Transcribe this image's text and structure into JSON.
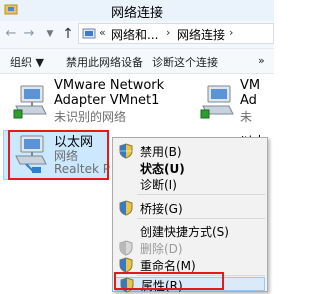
{
  "window": {
    "title": "网络连接"
  },
  "address_bar": {
    "overflow": "«",
    "crumbs": [
      "网络和...",
      "网络连接"
    ],
    "separator": "›"
  },
  "toolbar": {
    "organize": "组织 ▼",
    "disable_device": "禁用此网络设备",
    "diagnose": "诊断这个连接",
    "more": "»"
  },
  "adapters": [
    {
      "name_line1": "VMware Network",
      "name_line2": "Adapter VMnet1",
      "status": "未识别的网络"
    },
    {
      "name": "以太网",
      "status": "网络",
      "device": "Realtek P"
    },
    {
      "name": "以太"
    },
    {
      "name": "VM",
      "name_line2": "Ad",
      "status": "未"
    }
  ],
  "context_menu": {
    "items": [
      {
        "label": "禁用(B)"
      },
      {
        "label": "状态(U)"
      },
      {
        "label": "诊断(I)"
      },
      {
        "label": "桥接(G)"
      },
      {
        "label": "创建快捷方式(S)"
      },
      {
        "label": "删除(D)"
      },
      {
        "label": "重命名(M)"
      },
      {
        "label": "属性(R)"
      }
    ]
  },
  "colors": {
    "selection": "#cce8ff",
    "highlight_box": "#e21a1a",
    "menu_bg": "#f2f2f2"
  }
}
